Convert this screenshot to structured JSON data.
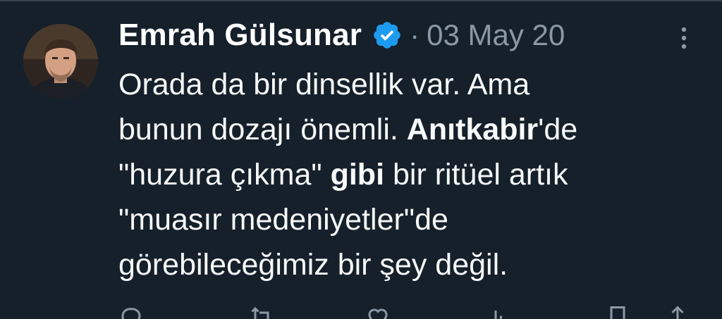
{
  "tweet": {
    "author_name": "Emrah Gülsunar",
    "verified": true,
    "date_separator": "·",
    "date": "03 May 20",
    "text_lines": [
      [
        {
          "t": "Orada da bir dinsellik var. Ama",
          "b": false
        }
      ],
      [
        {
          "t": "bunun dozajı önemli. ",
          "b": false
        },
        {
          "t": "Anıtkabir",
          "b": true
        },
        {
          "t": "'de",
          "b": false
        }
      ],
      [
        {
          "t": "\"huzura çıkma\" ",
          "b": false
        },
        {
          "t": "gibi",
          "b": true
        },
        {
          "t": " bir ritüel artık",
          "b": false
        }
      ],
      [
        {
          "t": "\"muasır medeniyetler\"de",
          "b": false
        }
      ],
      [
        {
          "t": "görebileceğimiz bir şey değil.",
          "b": false
        }
      ]
    ]
  },
  "icons": {
    "avatar": "avatar-photo",
    "verified": "verified-badge-icon",
    "more": "more-options-icon",
    "actions": [
      "reply-icon",
      "retweet-icon",
      "like-icon",
      "views-icon",
      "bookmark-icon",
      "share-icon"
    ]
  },
  "colors": {
    "background": "#15202b",
    "text": "#f7f9f9",
    "muted": "#8b98a5",
    "verified": "#1d9bf0"
  }
}
